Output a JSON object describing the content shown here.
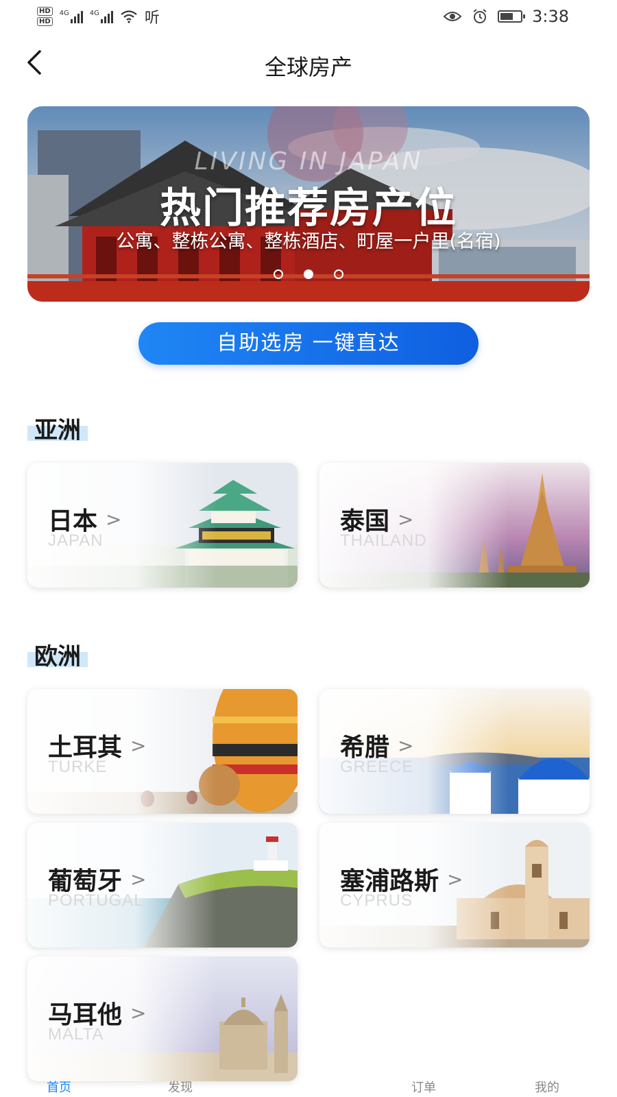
{
  "status_bar": {
    "hd1": "HD",
    "hd2": "HD",
    "signal1": "4G",
    "signal2": "4G",
    "hear_label": "听",
    "time": "3:38",
    "icons": [
      "eye-icon",
      "alarm-icon",
      "battery-icon"
    ]
  },
  "nav": {
    "back_icon": "chevron-left-icon",
    "title": "全球房产"
  },
  "banner": {
    "subtitle_en": "LIVING IN JAPAN",
    "title": "热门推荐房产位",
    "description": "公寓、整栋公寓、整栋酒店、町屋一户里(名宿)",
    "slide_count": 3,
    "active_index": 1
  },
  "cta_button": {
    "label": "自助选房 一键直达",
    "color": "#1877f0"
  },
  "regions": [
    {
      "title": "亚洲",
      "countries": [
        {
          "name": "日本",
          "en": "JAPAN"
        },
        {
          "name": "泰国",
          "en": "THAILAND"
        }
      ]
    },
    {
      "title": "欧洲",
      "countries": [
        {
          "name": "土耳其",
          "en": "TURKE"
        },
        {
          "name": "希腊",
          "en": "GREECE"
        },
        {
          "name": "葡萄牙",
          "en": "PORTUGAL"
        },
        {
          "name": "塞浦路斯",
          "en": "CYPRUS"
        },
        {
          "name": "马耳他",
          "en": "MALTA"
        }
      ]
    }
  ],
  "chevron": ">",
  "tabbar": {
    "tabs": [
      {
        "label": "首页",
        "active": true
      },
      {
        "label": "发现",
        "active": false
      },
      {
        "label": "订单",
        "active": false
      },
      {
        "label": "我的",
        "active": false
      }
    ],
    "accent": "#1f86f5"
  }
}
